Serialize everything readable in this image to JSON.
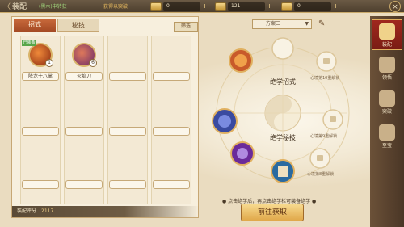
{
  "topbar": {
    "back": "〈",
    "title": "装配",
    "scroll_text_1": "(黑木)中转获",
    "scroll_text_2": "获得以突破",
    "resources": [
      {
        "icon": "jade-ingot-icon",
        "value": "0"
      },
      {
        "icon": "gold-ingot-icon",
        "value": "121"
      },
      {
        "icon": "scroll-ticket-icon",
        "value": "0"
      }
    ],
    "close": "×"
  },
  "tabs": {
    "active": "招式",
    "inactive": "秘技"
  },
  "filter_label": "筛选",
  "slots": [
    {
      "label": "降龙十八掌",
      "badge": "1",
      "tag": "已装备"
    },
    {
      "label": "火焰刀",
      "badge": "6",
      "tag": ""
    }
  ],
  "score": {
    "label": "装配评分",
    "value": "2117"
  },
  "scheme": {
    "label": "方案二",
    "arrow": "▼"
  },
  "edit_icon": "✎",
  "wheel": {
    "top_label": "绝学招式",
    "bottom_label": "绝学秘技",
    "locked": [
      "心境第10重解锁",
      "心境第9重解锁",
      "心境第8重解锁"
    ]
  },
  "hint": "● 点击绝学后，再点击绝学栏可装备绝学 ●",
  "go_button": "前往获取",
  "nav": [
    {
      "label": "装配",
      "icon": "equip-icon",
      "active": true
    },
    {
      "label": "领悟",
      "icon": "comprehend-icon",
      "active": false
    },
    {
      "label": "突破",
      "icon": "breakthrough-icon",
      "active": false
    },
    {
      "label": "至宝",
      "icon": "treasure-icon",
      "active": false
    }
  ],
  "colors": {
    "accent": "#a44a24",
    "gold": "#e0a84a",
    "nav_bg": "#4a3626"
  }
}
